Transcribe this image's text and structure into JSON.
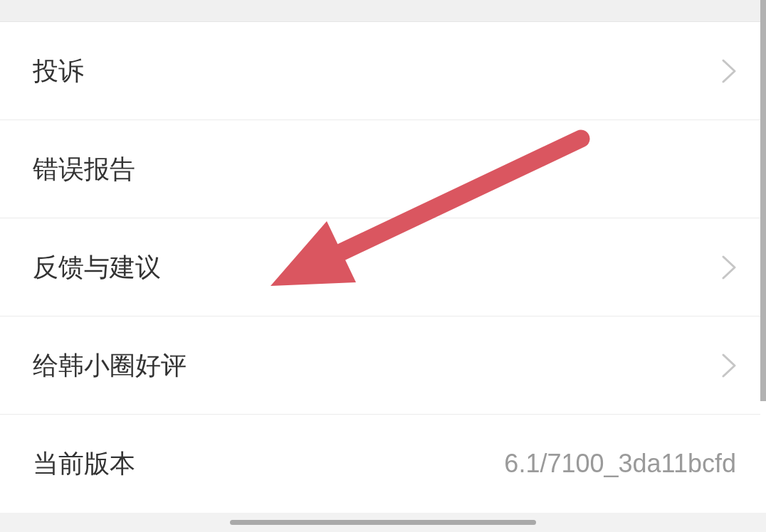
{
  "rows": [
    {
      "kind": "link",
      "label": "投诉"
    },
    {
      "kind": "plain",
      "label": "错误报告"
    },
    {
      "kind": "link",
      "label": "反馈与建议"
    },
    {
      "kind": "link",
      "label": "给韩小圈好评"
    },
    {
      "kind": "value",
      "label": "当前版本",
      "value": "6.1/7100_3da11bcfd"
    }
  ]
}
